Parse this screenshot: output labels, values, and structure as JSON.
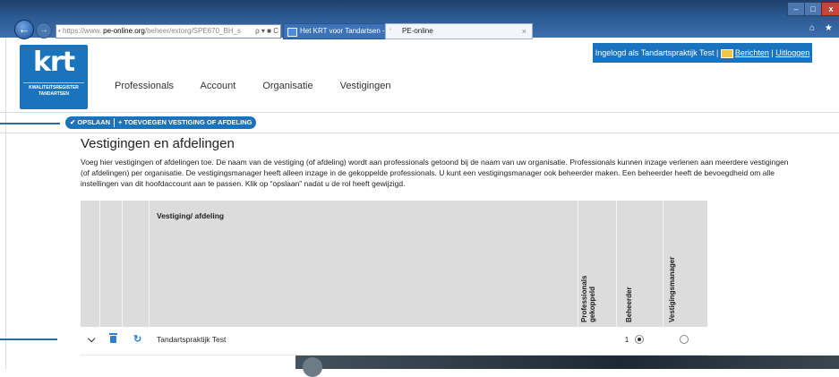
{
  "browser": {
    "address": {
      "lead": "• https://www.",
      "host": "pe-online.org",
      "path": "/beheer/extorg/SPE670_BH_s",
      "tools": "ρ ▾ ■ C"
    },
    "tabs": [
      {
        "label": "Het KRT voor Tandartsen - Kw..."
      },
      {
        "label": "PE-online",
        "close": "×"
      }
    ],
    "window": {
      "minimize": "–",
      "maximize": "□",
      "close": "x"
    },
    "toolbar_icons": "⌂ ★"
  },
  "header": {
    "logo": {
      "mark": "krt",
      "sub_line1": "KWALITEITSREGISTER",
      "sub_line2": "TANDARTSEN"
    },
    "userbar": {
      "logged_in": "Ingelogd als Tandartspraktijk Test |",
      "messages": "Berichten",
      "separator": "|",
      "logout": "Uitloggen"
    },
    "nav": [
      "Professionals",
      "Account",
      "Organisatie",
      "Vestigingen"
    ]
  },
  "actions": {
    "save": "✔ OPSLAAN",
    "add": "+ TOEVOEGEN VESTIGING OF AFDELING"
  },
  "content": {
    "title": "Vestigingen en afdelingen",
    "description": "Voeg hier vestigingen of afdelingen toe. De naam van de vestiging (of afdeling) wordt aan professionals getoond bij de naam van uw organisatie. Professionals kunnen inzage verlenen aan meerdere vestigingen (of afdelingen) per organisatie. De vestigingsmanager heeft alleen inzage in de gekoppelde professionals. U kunt een vestigingsmanager ook beheerder maken. Een beheerder heeft de bevoegdheid om alle instellingen van dit hoofdaccount aan te passen. Klik op “opslaan” nadat u de rol heeft gewijzigd."
  },
  "table": {
    "headers": {
      "name": "Vestiging/ afdeling",
      "professionals_line1": "Professionals",
      "professionals_line2": "gekoppeld",
      "admin": "Beheerder",
      "manager": "Vestigingsmanager"
    },
    "rows": [
      {
        "expand_icon": "⌵",
        "sync_icon": "↻",
        "name": "Tandartspraktijk Test",
        "professionals": "1",
        "beheerder": true,
        "vestigingsmanager": false
      }
    ]
  }
}
